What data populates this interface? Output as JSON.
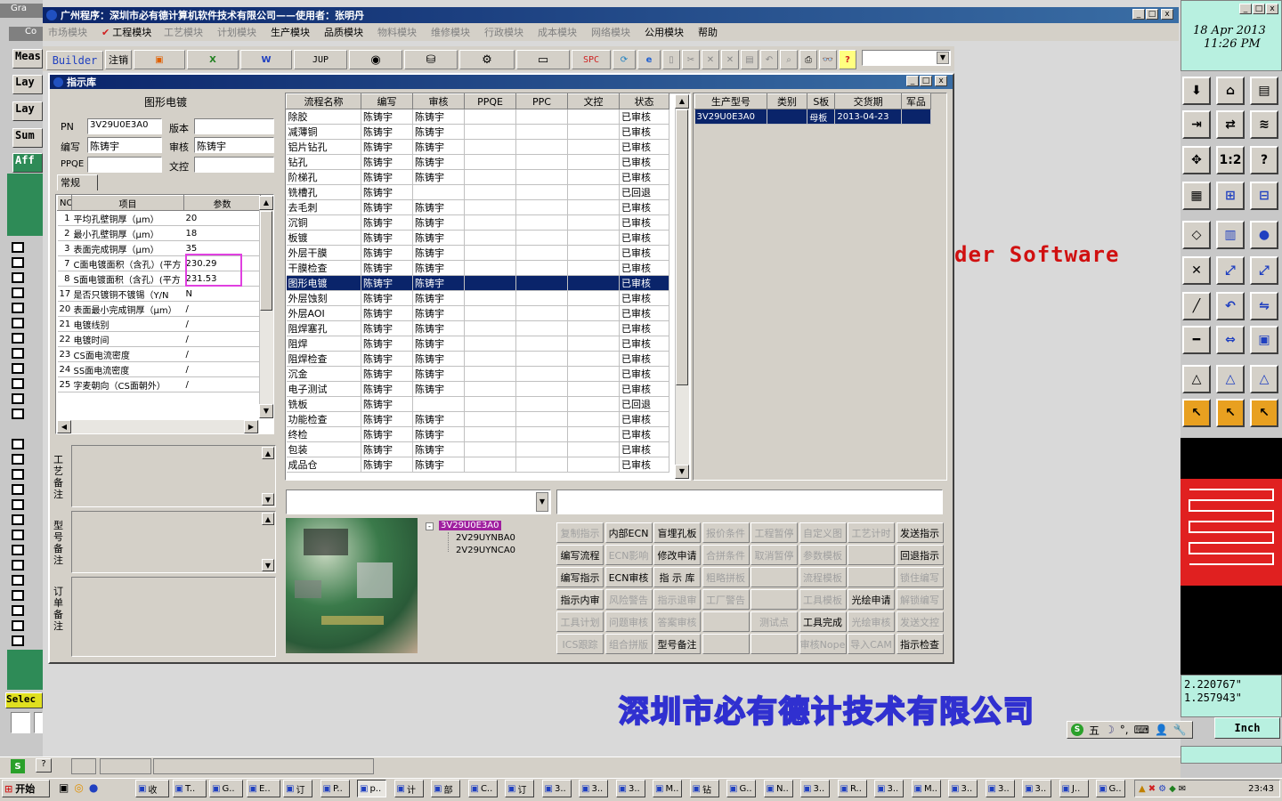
{
  "main_window": {
    "title": "广州程序：深圳市必有德计算机软件技术有限公司——使用者：张明丹"
  },
  "menu": [
    {
      "label": "市场模块",
      "enabled": false
    },
    {
      "label": "工程模块",
      "enabled": true,
      "checked": true
    },
    {
      "label": "工艺模块",
      "enabled": false
    },
    {
      "label": "计划模块",
      "enabled": false
    },
    {
      "label": "生产模块",
      "enabled": true
    },
    {
      "label": "品质模块",
      "enabled": true
    },
    {
      "label": "物料模块",
      "enabled": false
    },
    {
      "label": "维修模块",
      "enabled": false
    },
    {
      "label": "行政模块",
      "enabled": false
    },
    {
      "label": "成本模块",
      "enabled": false
    },
    {
      "label": "网络模块",
      "enabled": false
    },
    {
      "label": "公用模块",
      "enabled": true
    },
    {
      "label": "帮助",
      "enabled": true
    }
  ],
  "toolbar": {
    "builder": "Builder",
    "logout": "注销",
    "jup": "JUP",
    "spc": "SPC"
  },
  "cam": {
    "left_labels": [
      "Meas",
      "Lay",
      "Lay",
      "Sum",
      "Aff"
    ],
    "select_label": "Selec",
    "date": "18 Apr 2013",
    "time": "11:26 PM",
    "coord_x": "2.220767\"",
    "coord_y": "1.257943\"",
    "units": "Inch",
    "watermark": "der Software",
    "company_bottom": "深圳市必有德计技术有限公司",
    "cam_partial_title_1": "Gra",
    "cam_partial_title_2": "Co"
  },
  "dialog": {
    "title": "指示库",
    "section_title": "图形电镀",
    "pn_label": "PN",
    "pn_value": "3V29U0E3A0",
    "version_label": "版本",
    "version_value": "",
    "writer_label": "编写",
    "writer_value": "陈铸宇",
    "reviewer_label": "审核",
    "reviewer_value": "陈铸宇",
    "ppqe_label": "PPQE",
    "ppqe_value": "",
    "doc_label": "文控",
    "doc_value": "",
    "tab": "常规",
    "param_headers": [
      "NO",
      "项目",
      "参数"
    ],
    "params": [
      {
        "no": "1",
        "item": "平均孔壁铜厚（μm）",
        "val": "20"
      },
      {
        "no": "2",
        "item": "最小孔壁铜厚（μm）",
        "val": "18"
      },
      {
        "no": "3",
        "item": "表面完成铜厚（μm）",
        "val": "35"
      },
      {
        "no": "7",
        "item": "C面电镀面积（含孔）(平方",
        "val": "230.29"
      },
      {
        "no": "8",
        "item": "S面电镀面积（含孔）(平方",
        "val": "231.53"
      },
      {
        "no": "17",
        "item": "是否只镀铜不镀锡（Y/N",
        "val": "N"
      },
      {
        "no": "20",
        "item": "表面最小完成铜厚（μm）",
        "val": "/"
      },
      {
        "no": "21",
        "item": "电镀线别",
        "val": "/"
      },
      {
        "no": "22",
        "item": "电镀时间",
        "val": "/"
      },
      {
        "no": "23",
        "item": "CS面电流密度",
        "val": "/"
      },
      {
        "no": "24",
        "item": "SS面电流密度",
        "val": "/"
      },
      {
        "no": "25",
        "item": "字麦朝向（CS面朝外）",
        "val": "/"
      }
    ],
    "note_labels": [
      "工艺备注",
      "型号备注",
      "订单备注"
    ],
    "process_headers": [
      "流程名称",
      "编写",
      "审核",
      "PPQE",
      "PPC",
      "文控",
      "状态"
    ],
    "processes": [
      [
        "除胶",
        "陈铸宇",
        "陈铸宇",
        "",
        "",
        "",
        "已审核"
      ],
      [
        "减薄铜",
        "陈铸宇",
        "陈铸宇",
        "",
        "",
        "",
        "已审核"
      ],
      [
        "铝片钻孔",
        "陈铸宇",
        "陈铸宇",
        "",
        "",
        "",
        "已审核"
      ],
      [
        "钻孔",
        "陈铸宇",
        "陈铸宇",
        "",
        "",
        "",
        "已审核"
      ],
      [
        "阶梯孔",
        "陈铸宇",
        "陈铸宇",
        "",
        "",
        "",
        "已审核"
      ],
      [
        "铣槽孔",
        "陈铸宇",
        "",
        "",
        "",
        "",
        "已回退"
      ],
      [
        "去毛刺",
        "陈铸宇",
        "陈铸宇",
        "",
        "",
        "",
        "已审核"
      ],
      [
        "沉铜",
        "陈铸宇",
        "陈铸宇",
        "",
        "",
        "",
        "已审核"
      ],
      [
        "板镀",
        "陈铸宇",
        "陈铸宇",
        "",
        "",
        "",
        "已审核"
      ],
      [
        "外层干膜",
        "陈铸宇",
        "陈铸宇",
        "",
        "",
        "",
        "已审核"
      ],
      [
        "干膜检查",
        "陈铸宇",
        "陈铸宇",
        "",
        "",
        "",
        "已审核"
      ],
      [
        "图形电镀",
        "陈铸宇",
        "陈铸宇",
        "",
        "",
        "",
        "已审核"
      ],
      [
        "外层蚀刻",
        "陈铸宇",
        "陈铸宇",
        "",
        "",
        "",
        "已审核"
      ],
      [
        "外层AOI",
        "陈铸宇",
        "陈铸宇",
        "",
        "",
        "",
        "已审核"
      ],
      [
        "阻焊塞孔",
        "陈铸宇",
        "陈铸宇",
        "",
        "",
        "",
        "已审核"
      ],
      [
        "阻焊",
        "陈铸宇",
        "陈铸宇",
        "",
        "",
        "",
        "已审核"
      ],
      [
        "阻焊检查",
        "陈铸宇",
        "陈铸宇",
        "",
        "",
        "",
        "已审核"
      ],
      [
        "沉金",
        "陈铸宇",
        "陈铸宇",
        "",
        "",
        "",
        "已审核"
      ],
      [
        "电子测试",
        "陈铸宇",
        "陈铸宇",
        "",
        "",
        "",
        "已审核"
      ],
      [
        "铣板",
        "陈铸宇",
        "",
        "",
        "",
        "",
        "已回退"
      ],
      [
        "功能检查",
        "陈铸宇",
        "陈铸宇",
        "",
        "",
        "",
        "已审核"
      ],
      [
        "终检",
        "陈铸宇",
        "陈铸宇",
        "",
        "",
        "",
        "已审核"
      ],
      [
        "包装",
        "陈铸宇",
        "陈铸宇",
        "",
        "",
        "",
        "已审核"
      ],
      [
        "成品仓",
        "陈铸宇",
        "陈铸宇",
        "",
        "",
        "",
        "已审核"
      ]
    ],
    "selected_process": 11,
    "order_headers": [
      "生产型号",
      "类别",
      "S板",
      "交货期",
      "军品"
    ],
    "orders": [
      [
        "3V29U0E3A0",
        "",
        "母板",
        "2013-04-23",
        ""
      ]
    ],
    "tree": {
      "root": "3V29U0E3A0",
      "children": [
        "2V29UYNBA0",
        "2V29UYNCA0"
      ]
    },
    "action_buttons": [
      [
        {
          "l": "复制指示",
          "e": false
        },
        {
          "l": "内部ECN",
          "e": true
        },
        {
          "l": "盲埋孔板",
          "e": true
        },
        {
          "l": "报价条件",
          "e": false
        },
        {
          "l": "工程暂停",
          "e": false
        },
        {
          "l": "自定义图",
          "e": false
        },
        {
          "l": "工艺计时",
          "e": false
        },
        {
          "l": "发送指示",
          "e": true
        }
      ],
      [
        {
          "l": "编写流程",
          "e": true
        },
        {
          "l": "ECN影响",
          "e": false
        },
        {
          "l": "修改申请",
          "e": true
        },
        {
          "l": "合拼条件",
          "e": false
        },
        {
          "l": "取消暂停",
          "e": false
        },
        {
          "l": "参数模板",
          "e": false
        },
        {
          "l": "",
          "e": false
        },
        {
          "l": "回退指示",
          "e": true
        }
      ],
      [
        {
          "l": "编写指示",
          "e": true
        },
        {
          "l": "ECN审核",
          "e": true
        },
        {
          "l": "指 示 库",
          "e": true
        },
        {
          "l": "粗略拼板",
          "e": false
        },
        {
          "l": "",
          "e": false
        },
        {
          "l": "流程模板",
          "e": false
        },
        {
          "l": "",
          "e": false
        },
        {
          "l": "锁住编写",
          "e": false
        }
      ],
      [
        {
          "l": "指示内审",
          "e": true
        },
        {
          "l": "风险警告",
          "e": false
        },
        {
          "l": "指示退审",
          "e": false
        },
        {
          "l": "工厂警告",
          "e": false
        },
        {
          "l": "",
          "e": false
        },
        {
          "l": "工具模板",
          "e": false
        },
        {
          "l": "光绘申请",
          "e": true
        },
        {
          "l": "解锁编写",
          "e": false
        }
      ],
      [
        {
          "l": "工具计划",
          "e": false
        },
        {
          "l": "问题审核",
          "e": false
        },
        {
          "l": "答案审核",
          "e": false
        },
        {
          "l": "",
          "e": false
        },
        {
          "l": "测试点",
          "e": false
        },
        {
          "l": "工具完成",
          "e": true
        },
        {
          "l": "光绘审核",
          "e": false
        },
        {
          "l": "发送文控",
          "e": false
        }
      ],
      [
        {
          "l": "ICS跟踪",
          "e": false
        },
        {
          "l": "组合拼版",
          "e": false
        },
        {
          "l": "型号备注",
          "e": true
        },
        {
          "l": "",
          "e": false
        },
        {
          "l": "",
          "e": false
        },
        {
          "l": "审核Nope",
          "e": false
        },
        {
          "l": "导入CAM",
          "e": false
        },
        {
          "l": "指示检查",
          "e": true
        }
      ]
    ]
  },
  "ime": {
    "label": "五"
  },
  "taskbar": {
    "start": "开始",
    "clock": "23:43",
    "tasks": [
      "收",
      "T..",
      "G..",
      "E..",
      "订",
      "P..",
      "p..",
      "计",
      "部",
      "C..",
      "订",
      "3..",
      "3..",
      "3..",
      "M..",
      "钻",
      "G..",
      "N..",
      "3..",
      "R..",
      "3..",
      "M..",
      "3..",
      "3..",
      "3..",
      "J..",
      "G.."
    ]
  }
}
